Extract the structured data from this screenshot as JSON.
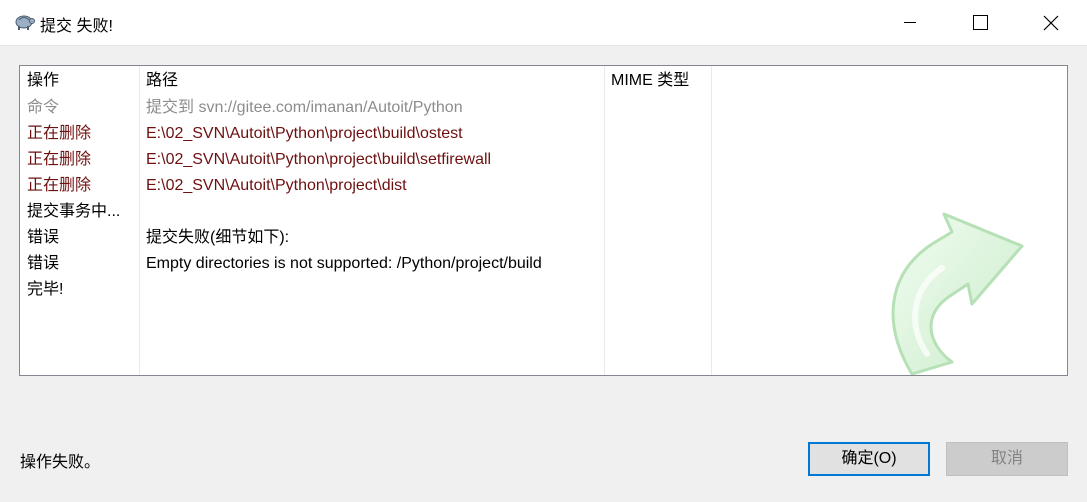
{
  "window": {
    "title": "提交 失败!",
    "app_icon": "tortoise-icon",
    "controls": [
      "minimize-icon",
      "maximize-icon",
      "close-icon"
    ]
  },
  "list": {
    "headers": {
      "action": "操作",
      "path": "路径",
      "mime": "MIME 类型"
    },
    "rows": [
      {
        "action": "命令",
        "path": "提交到 svn://gitee.com/imanan/Autoit/Python",
        "color": "gray"
      },
      {
        "action": "正在删除",
        "path": "E:\\02_SVN\\Autoit\\Python\\project\\build\\ostest",
        "color": "red"
      },
      {
        "action": "正在删除",
        "path": "E:\\02_SVN\\Autoit\\Python\\project\\build\\setfirewall",
        "color": "red"
      },
      {
        "action": "正在删除",
        "path": "E:\\02_SVN\\Autoit\\Python\\project\\dist",
        "color": "red"
      },
      {
        "action": "提交事务中...",
        "path": "",
        "color": "black"
      },
      {
        "action": "错误",
        "path": "提交失败(细节如下):",
        "color": "black"
      },
      {
        "action": "错误",
        "path": "Empty directories is not supported: /Python/project/build",
        "color": "black"
      },
      {
        "action": "完毕!",
        "path": "",
        "color": "black"
      }
    ],
    "decoration": "green-curved-arrow-icon"
  },
  "status_text": "操作失败。",
  "buttons": {
    "ok": "确定(O)",
    "cancel": "取消"
  },
  "colors": {
    "red_text": "#6e1010",
    "gray_text": "#8c8c8c",
    "focus_border": "#0078d7"
  }
}
